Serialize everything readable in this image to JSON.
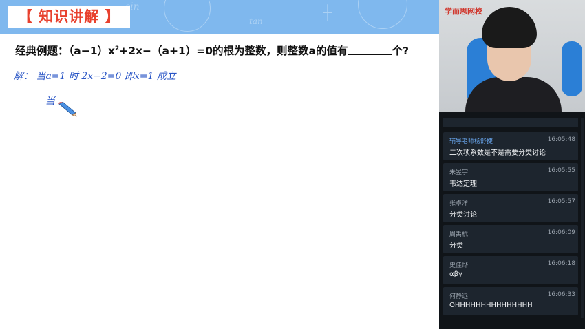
{
  "lesson": {
    "section_title": "【 知识讲解 】",
    "question": {
      "prefix": "经典例题：（a−1）x",
      "sup": "2",
      "middle": "+2x−（a+1）=0的根为整数，则整数a的值有",
      "suffix": "个?"
    },
    "handwriting": {
      "line1": "解：  当a=1 时   2x−2=0   即x=1  成立",
      "line2": "当"
    }
  },
  "video": {
    "logo": "学而思网校"
  },
  "chat": {
    "messages": [
      {
        "name": "辅导老师杨舒捷",
        "time": "16:05:48",
        "text": "二次项系数是不是需要分类讨论",
        "teacher": true
      },
      {
        "name": "朱昱宇",
        "time": "16:05:55",
        "text": "韦达定理"
      },
      {
        "name": "张卓洋",
        "time": "16:05:57",
        "text": "分类讨论"
      },
      {
        "name": "周禹杭",
        "time": "16:06:09",
        "text": "分类"
      },
      {
        "name": "史佳烨",
        "time": "16:06:18",
        "text": "αβγ"
      },
      {
        "name": "何静远",
        "time": "16:06:33",
        "text": "OHHHHHHHHHHHHHHH"
      }
    ]
  },
  "colors": {
    "header_bg": "#7fb8ee",
    "title_red": "#e8412e",
    "handwriting_blue": "#2a56c6",
    "chat_bg": "#101418",
    "chat_card": "#1d252e",
    "teacher_name": "#6aa8f0"
  }
}
